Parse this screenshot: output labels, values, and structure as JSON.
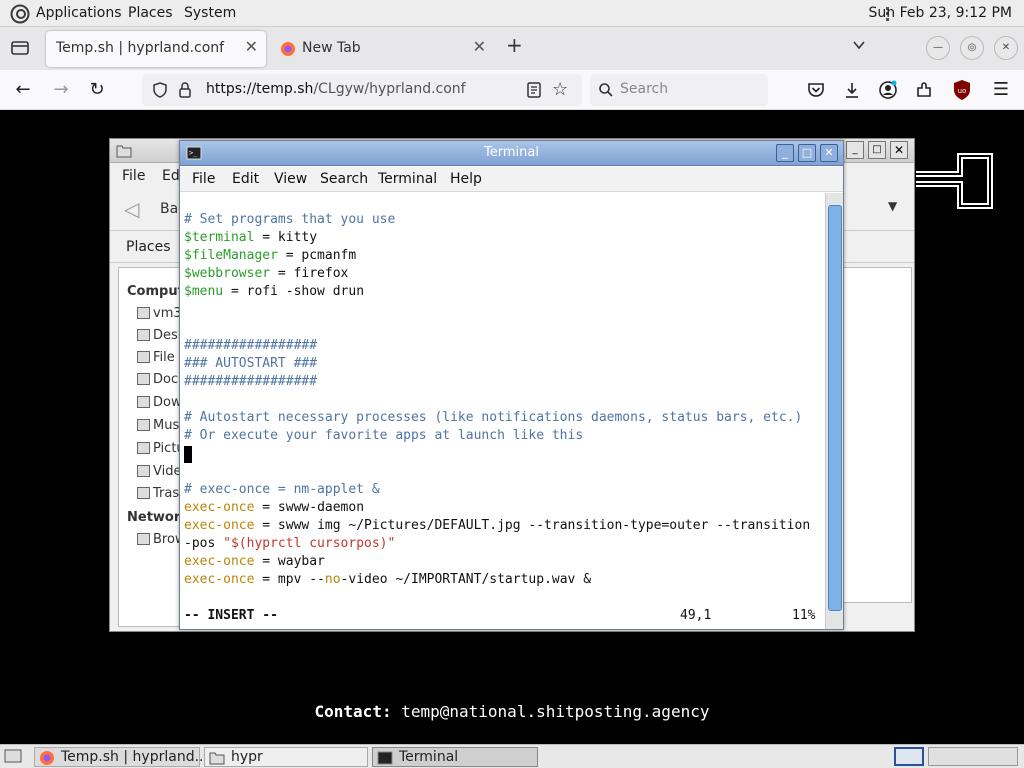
{
  "top_panel": {
    "menus": [
      "Applications",
      "Places",
      "System"
    ],
    "clock": "Sun Feb 23,  9:12 PM"
  },
  "browser": {
    "tabs": [
      {
        "label": "Temp.sh | hyprland.conf",
        "active": true
      },
      {
        "label": "New Tab",
        "active": false
      }
    ],
    "url_host": "https://temp.sh",
    "url_path": "/CLgyw/hyprland.conf",
    "search_placeholder": "Search"
  },
  "file_manager": {
    "menu": [
      "File",
      "Edi"
    ],
    "toolbar_back": "Bac",
    "places_label": "Places",
    "sidebar": [
      {
        "label": "Compute",
        "heading": true
      },
      {
        "label": "vm3"
      },
      {
        "label": "Desk"
      },
      {
        "label": "File S"
      },
      {
        "label": "Docu"
      },
      {
        "label": "Dow"
      },
      {
        "label": "Musi"
      },
      {
        "label": "Pictu"
      },
      {
        "label": "Vide"
      },
      {
        "label": "Trasl"
      },
      {
        "label": "Network",
        "heading": true
      },
      {
        "label": "Brow"
      }
    ]
  },
  "terminal": {
    "title": "Terminal",
    "menu": [
      "File",
      "Edit",
      "View",
      "Search",
      "Terminal",
      "Help"
    ],
    "lines": {
      "l1": "# Set programs that you use",
      "l2_var": "$terminal",
      "l2_rest": " = kitty",
      "l3_var": "$fileManager",
      "l3_rest": " = pcmanfm",
      "l4_var": "$webbrowser",
      "l4_rest": " = firefox",
      "l5_var": "$menu",
      "l5_rest": " = rofi -show drun",
      "l6": "#################",
      "l7": "### AUTOSTART ###",
      "l8": "#################",
      "l9": "# Autostart necessary processes (like notifications daemons, status bars, etc.)",
      "l10": "# Or execute your favorite apps at launch like this",
      "l11": "# exec-once = nm-applet &",
      "l12_kw": "exec-once",
      "l12_rest": " = swww-daemon",
      "l13_kw": "exec-once",
      "l13_rest": " = swww img ~/Pictures/DEFAULT.jpg --transition-type=outer --transition",
      "l14_a": "-pos ",
      "l14_str": "\"$(hyprctl cursorpos)\"",
      "l15_kw": "exec-once",
      "l15_rest": " = waybar",
      "l16_kw": "exec-once",
      "l16_a": " = mpv --",
      "l16_no": "no",
      "l16_b": "-video ~/IMPORTANT/startup.wav &"
    },
    "status_mode": "-- INSERT --",
    "status_pos": "49,1",
    "status_pct": "11%"
  },
  "contact": {
    "label": "Contact:",
    "value": "temp@national.shitposting.agency"
  },
  "taskbar": {
    "tasks": [
      "Temp.sh | hyprland....",
      "hypr",
      "Terminal"
    ]
  },
  "colors": {
    "comment": "#4f75a4",
    "variable": "#2b9d2b",
    "keyword": "#b8860b",
    "string": "#c0392b"
  }
}
